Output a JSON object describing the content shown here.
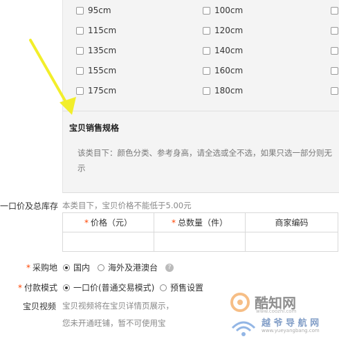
{
  "sizes": [
    [
      "95cm",
      "100cm"
    ],
    [
      "115cm",
      "120cm"
    ],
    [
      "135cm",
      "140cm"
    ],
    [
      "155cm",
      "160cm"
    ],
    [
      "175cm",
      "180cm"
    ]
  ],
  "spec": {
    "title": "宝贝销售规格",
    "hint_line1": "该类目下：颜色分类、参考身高，请全选或全不选，如果只选一部分则无",
    "hint_line2": "示"
  },
  "price": {
    "label": "一口价及总库存",
    "note": "本类目下，宝贝价格不能低于5.00元",
    "headers": [
      "*价格（元）",
      "*总数量（件）",
      "商家编码"
    ]
  },
  "origin": {
    "label": "采购地",
    "options": [
      "国内",
      "海外及港澳台"
    ],
    "selected": "国内"
  },
  "payment": {
    "label": "付款模式",
    "options": [
      "一口价(普通交易模式)",
      "预售设置"
    ],
    "selected": "一口价(普通交易模式)"
  },
  "video": {
    "label": "宝贝视频",
    "line1": "宝贝视频将在宝贝详情页展示，",
    "line2": "您未开通旺铺，暂不可使用宝"
  },
  "watermark": {
    "text1": "酷知网",
    "text2": "www.coozhi.com",
    "text3": "越 爷 导 航 网",
    "text4": "www.yueyangbang.com"
  },
  "colors": {
    "accent": "#ff4400",
    "arrow": "#f2ee2a"
  }
}
